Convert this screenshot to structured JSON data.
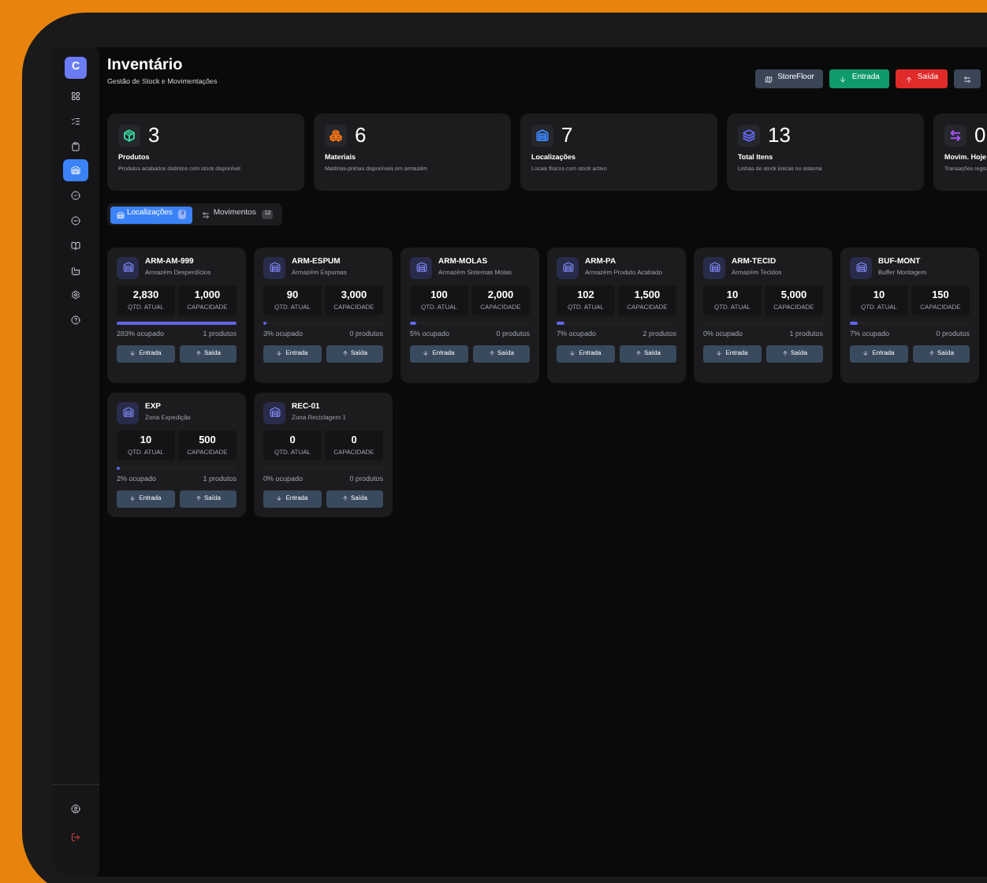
{
  "sidebar": {
    "logo": "C",
    "items": [
      {
        "selected": false
      },
      {
        "selected": false
      },
      {
        "selected": false
      },
      {
        "selected": true
      },
      {
        "selected": false
      },
      {
        "selected": false
      },
      {
        "selected": false
      },
      {
        "selected": false
      },
      {
        "selected": false
      },
      {
        "selected": false
      }
    ]
  },
  "header": {
    "title": "Inventário",
    "subtitle": "Gestão de Stock e Movimentações",
    "buttons": [
      {
        "kind": "storefloor",
        "label": "StoreFloor"
      },
      {
        "kind": "entry",
        "label": "Entrada"
      },
      {
        "kind": "exit",
        "label": "Saída"
      },
      {
        "kind": "transfer"
      }
    ]
  },
  "stats": [
    {
      "color": "#34d399",
      "value": "3",
      "label": "Produtos",
      "description": "Produtos acabados distintos com stock disponível"
    },
    {
      "color": "#f97316",
      "value": "6",
      "label": "Materiais",
      "description": "Matérias-primas disponíveis em armazém"
    },
    {
      "color": "#3b82f6",
      "value": "7",
      "label": "Localizações",
      "description": "Locais físicos com stock activo"
    },
    {
      "color": "#6366f1",
      "value": "13",
      "label": "Total Itens",
      "description": "Linhas de stock únicas no sistema"
    },
    {
      "color": "#a855f7",
      "value": "0",
      "label": "Movim. Hoje",
      "description": "Transações regis"
    }
  ],
  "tabs": [
    {
      "label": "Localizações",
      "count": "9",
      "selected": true
    },
    {
      "label": "Movimentos",
      "count": "12",
      "selected": false
    }
  ],
  "locations": [
    {
      "code": "ARM-AM-999",
      "name": "Armazém Desperdícios",
      "qty": "2,830",
      "qty_label": "QTD. ATUAL",
      "capacity": "1,000",
      "capacity_label": "CAPACIDADE",
      "level": 1,
      "occupancy": "283% ocupado",
      "products": "1 produtos",
      "entry_button": "Entrada",
      "exit_button": "Saída"
    },
    {
      "code": "ARM-ESPUM",
      "name": "Armazém Espumas",
      "qty": "90",
      "qty_label": "QTD. ATUAL",
      "capacity": "3,000",
      "capacity_label": "CAPACIDADE",
      "level": 0.03,
      "occupancy": "3% ocupado",
      "products": "0 produtos",
      "entry_button": "Entrada",
      "exit_button": "Saída"
    },
    {
      "code": "ARM-MOLAS",
      "name": "Armazém Sistemas Molas",
      "qty": "100",
      "qty_label": "QTD. ATUAL",
      "capacity": "2,000",
      "capacity_label": "CAPACIDADE",
      "level": 0.05,
      "occupancy": "5% ocupado",
      "products": "0 produtos",
      "entry_button": "Entrada",
      "exit_button": "Saída"
    },
    {
      "code": "ARM-PA",
      "name": "Armazém Produto Acabado",
      "qty": "102",
      "qty_label": "QTD. ATUAL",
      "capacity": "1,500",
      "capacity_label": "CAPACIDADE",
      "level": 0.07,
      "occupancy": "7% ocupado",
      "products": "2 produtos",
      "entry_button": "Entrada",
      "exit_button": "Saída"
    },
    {
      "code": "ARM-TECID",
      "name": "Armazém Tecidos",
      "qty": "10",
      "qty_label": "QTD. ATUAL",
      "capacity": "5,000",
      "capacity_label": "CAPACIDADE",
      "occupancy": "0% ocupado",
      "products": "1 produtos",
      "entry_button": "Entrada",
      "exit_button": "Saída"
    },
    {
      "code": "BUF-MONT",
      "name": "Buffer Montagem",
      "qty": "10",
      "qty_label": "QTD. ATUAL",
      "capacity": "150",
      "capacity_label": "CAPACIDADE",
      "level": 0.07,
      "occupancy": "7% ocupado",
      "products": "0 produtos",
      "entry_button": "Entrada",
      "exit_button": "Saída"
    },
    {
      "code": "EXP",
      "name": "Zona Expedição",
      "qty": "10",
      "qty_label": "QTD. ATUAL",
      "capacity": "500",
      "capacity_label": "CAPACIDADE",
      "level": 0.02,
      "occupancy": "2% ocupado",
      "products": "1 produtos",
      "entry_button": "Entrada",
      "exit_button": "Saída"
    },
    {
      "code": "REC-01",
      "name": "Zona Reciclagem 1",
      "qty": "0",
      "qty_label": "QTD. ATUAL",
      "capacity": "0",
      "capacity_label": "CAPACIDADE",
      "occupancy": "0% ocupado",
      "products": "0 produtos",
      "entry_button": "Entrada",
      "exit_button": "Saída"
    }
  ]
}
